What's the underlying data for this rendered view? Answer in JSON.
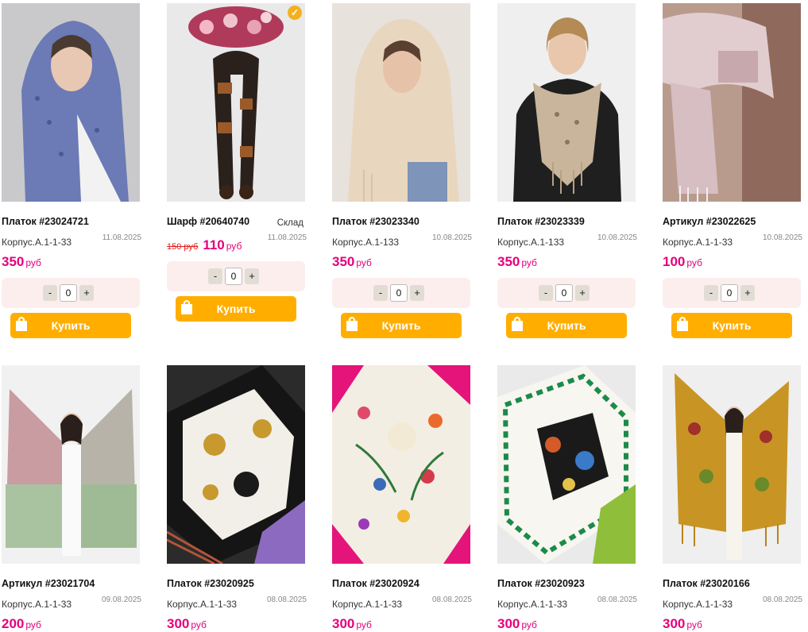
{
  "buy_label": "Купить",
  "currency": "руб",
  "stock_label": "Склад",
  "colors": {
    "price": "#e4007c",
    "buy_button": "#ffae00",
    "qty_bg": "#fdeeee"
  },
  "products": [
    {
      "title": "Платок #23024721",
      "location": "Корпус.А.1-1-33",
      "date": "11.08.2025",
      "price": "350",
      "qty": "0",
      "photo": "woman in blue monogram headscarf"
    },
    {
      "title": "Шарф #20640740",
      "location": "",
      "date": "11.08.2025",
      "price": "110",
      "old_price": "150 руб",
      "qty": "0",
      "photo": "brown and black patterned scarf with flowers"
    },
    {
      "title": "Платок #23023340",
      "location": "Корпус.А.1-133",
      "date": "10.08.2025",
      "price": "350",
      "qty": "0",
      "photo": "woman in beige headscarf"
    },
    {
      "title": "Платок #23023339",
      "location": "Корпус.А.1-133",
      "date": "10.08.2025",
      "price": "350",
      "qty": "0",
      "photo": "woman in beige monogram shawl"
    },
    {
      "title": "Артикул #23022625",
      "location": "Корпус.А.1-1-33",
      "date": "10.08.2025",
      "price": "100",
      "qty": "0",
      "photo": "pink plaid scarf"
    },
    {
      "title": "Артикул #23021704",
      "location": "Корпус.А.1-1-33",
      "date": "09.08.2025",
      "price": "200",
      "photo": "woman holding pink-green gradient scarf"
    },
    {
      "title": "Платок #23020925",
      "location": "Корпус.А.1-1-33",
      "date": "08.08.2025",
      "price": "300",
      "photo": "black and white silk scarf"
    },
    {
      "title": "Платок #23020924",
      "location": "Корпус.А.1-1-33",
      "date": "08.08.2025",
      "price": "300",
      "photo": "floral silk scarf"
    },
    {
      "title": "Платок #23020923",
      "location": "Корпус.А.1-1-33",
      "date": "08.08.2025",
      "price": "300",
      "photo": "white silk scarf with green border"
    },
    {
      "title": "Платок #23020166",
      "location": "Корпус.А.1-1-33",
      "date": "08.08.2025",
      "price": "300",
      "photo": "woman holding yellow floral shawl"
    }
  ]
}
